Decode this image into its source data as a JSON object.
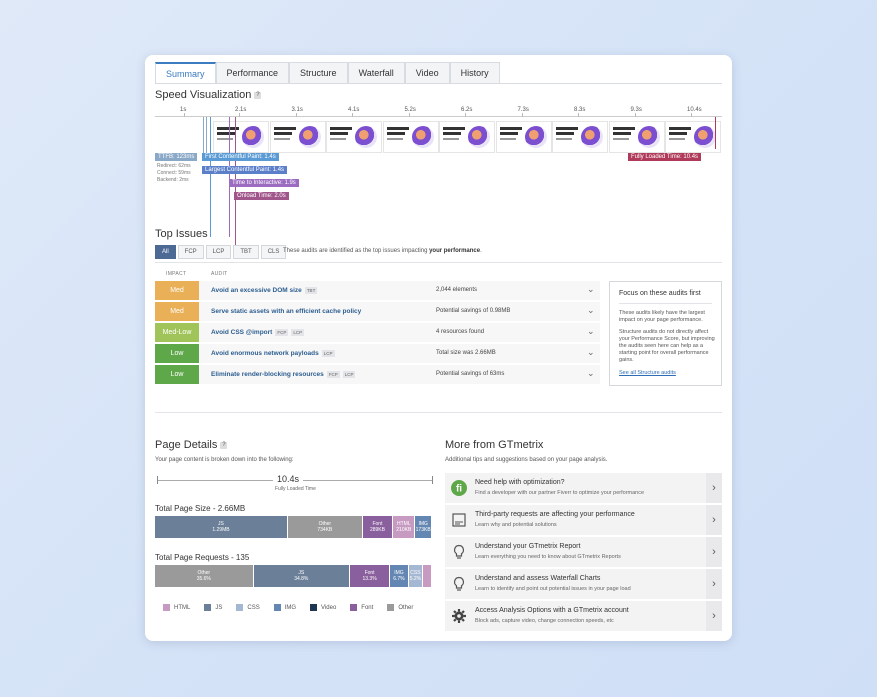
{
  "tabs": [
    "Summary",
    "Performance",
    "Structure",
    "Waterfall",
    "Video",
    "History"
  ],
  "active_tab": "Summary",
  "speed": {
    "title": "Speed Visualization",
    "help": "?",
    "timeline": [
      "1s",
      "2.1s",
      "3.1s",
      "4.1s",
      "5.2s",
      "6.2s",
      "7.3s",
      "8.3s",
      "9.3s",
      "10.4s"
    ],
    "thumb_count": 9,
    "ttfb": "TTFB: 123ms",
    "ttfb_details": [
      "Redirect: 62ms",
      "Connect: 59ms",
      "Backend: 2ms"
    ],
    "fcp": "First Contentful Paint: 1.4s",
    "lcp": "Largest Contentful Paint: 1.4s",
    "tti": "Time to Interactive: 1.9s",
    "onload": "Onload Time: 2.0s",
    "fully_loaded": "Fully Loaded Time: 10.4s",
    "colors": {
      "ttfb": "#8aa8c7",
      "fcp": "#5b9bd5",
      "lcp": "#5b7fc9",
      "tti": "#9b6cc0",
      "onload": "#a0558b",
      "fully": "#b03a5a"
    }
  },
  "top_issues": {
    "title": "Top Issues",
    "filters": [
      "All",
      "FCP",
      "LCP",
      "TBT",
      "CLS"
    ],
    "note_prefix": "These audits are identified as the top issues impacting ",
    "note_bold": "your performance",
    "note_suffix": ".",
    "col_impact": "IMPACT",
    "col_audit": "AUDIT",
    "items": [
      {
        "severity": "Med",
        "color": "#e9b057",
        "title": "Avoid an excessive DOM size",
        "tags": [
          "TBT"
        ],
        "result": "2,044 elements"
      },
      {
        "severity": "Med",
        "color": "#e9b057",
        "title": "Serve static assets with an efficient cache policy",
        "tags": [],
        "result": "Potential savings of 0.98MB"
      },
      {
        "severity": "Med-Low",
        "color": "#a1c45a",
        "title": "Avoid CSS @import",
        "tags": [
          "FCP",
          "LCP"
        ],
        "result": "4 resources found"
      },
      {
        "severity": "Low",
        "color": "#5fa84a",
        "title": "Avoid enormous network payloads",
        "tags": [
          "LCP"
        ],
        "result": "Total size was 2.66MB"
      },
      {
        "severity": "Low",
        "color": "#5fa84a",
        "title": "Eliminate render-blocking resources",
        "tags": [
          "FCP",
          "LCP"
        ],
        "result": "Potential savings of 63ms"
      }
    ],
    "focus": {
      "title": "Focus on these audits first",
      "p1": "These audits likely have the largest impact on your page performance.",
      "p2": "Structure audits do not directly affect your Performance Score, but improving the audits seen here can help as a starting point for overall performance gains.",
      "link": "See all Structure audits"
    }
  },
  "page_details": {
    "title": "Page Details",
    "help": "?",
    "subtitle": "Your page content is broken down into the following:",
    "fully_loaded_value": "10.4s",
    "fully_loaded_label": "Fully Loaded Time",
    "size_title": "Total Page Size - 2.66MB",
    "size_segments": [
      {
        "name": "JS",
        "value": "1.29MB",
        "pct": 48,
        "color": "#6b7f99"
      },
      {
        "name": "Other",
        "value": "734KB",
        "pct": 27,
        "color": "#9a9a9a"
      },
      {
        "name": "Font",
        "value": "289KB",
        "pct": 11,
        "color": "#8a5f9e"
      },
      {
        "name": "HTML",
        "value": "210KB",
        "pct": 8,
        "color": "#c79ac2"
      },
      {
        "name": "IMG",
        "value": "173KB",
        "pct": 6,
        "color": "#6486b3"
      }
    ],
    "req_title": "Total Page Requests - 135",
    "req_segments": [
      {
        "name": "Other",
        "value": "35.6%",
        "pct": 35.6,
        "color": "#9a9a9a"
      },
      {
        "name": "JS",
        "value": "34.8%",
        "pct": 34.8,
        "color": "#6b7f99"
      },
      {
        "name": "Font",
        "value": "13.3%",
        "pct": 14.5,
        "color": "#8a5f9e"
      },
      {
        "name": "IMG",
        "value": "6.7%",
        "pct": 6.7,
        "color": "#6486b3"
      },
      {
        "name": "CSS",
        "value": "5.2%",
        "pct": 5.2,
        "color": "#a5b8d3"
      },
      {
        "name": "",
        "value": "",
        "pct": 3.2,
        "color": "#c79ac2"
      }
    ],
    "legend": [
      {
        "name": "HTML",
        "color": "#c79ac2"
      },
      {
        "name": "JS",
        "color": "#6b7f99"
      },
      {
        "name": "CSS",
        "color": "#a5b8d3"
      },
      {
        "name": "IMG",
        "color": "#6486b3"
      },
      {
        "name": "Video",
        "color": "#1f3552"
      },
      {
        "name": "Font",
        "color": "#8a5f9e"
      },
      {
        "name": "Other",
        "color": "#9a9a9a"
      }
    ]
  },
  "more_from": {
    "title": "More from GTmetrix",
    "subtitle": "Additional tips and suggestions based on your page analysis.",
    "items": [
      {
        "icon": "fiverr-icon",
        "title": "Need help with optimization?",
        "sub": "Find a developer with our partner Fiverr to optimize your performance"
      },
      {
        "icon": "document-icon",
        "title": "Third-party requests are affecting your performance",
        "sub": "Learn why and potential solutions"
      },
      {
        "icon": "lightbulb-icon",
        "title": "Understand your GTmetrix Report",
        "sub": "Learn everything you need to know about GTmetrix Reports"
      },
      {
        "icon": "lightbulb-icon",
        "title": "Understand and assess Waterfall Charts",
        "sub": "Learn to identify and point out potential issues in your page load"
      },
      {
        "icon": "gear-icon",
        "title": "Access Analysis Options with a GTmetrix account",
        "sub": "Block ads, capture video, change connection speeds, etc"
      }
    ]
  }
}
